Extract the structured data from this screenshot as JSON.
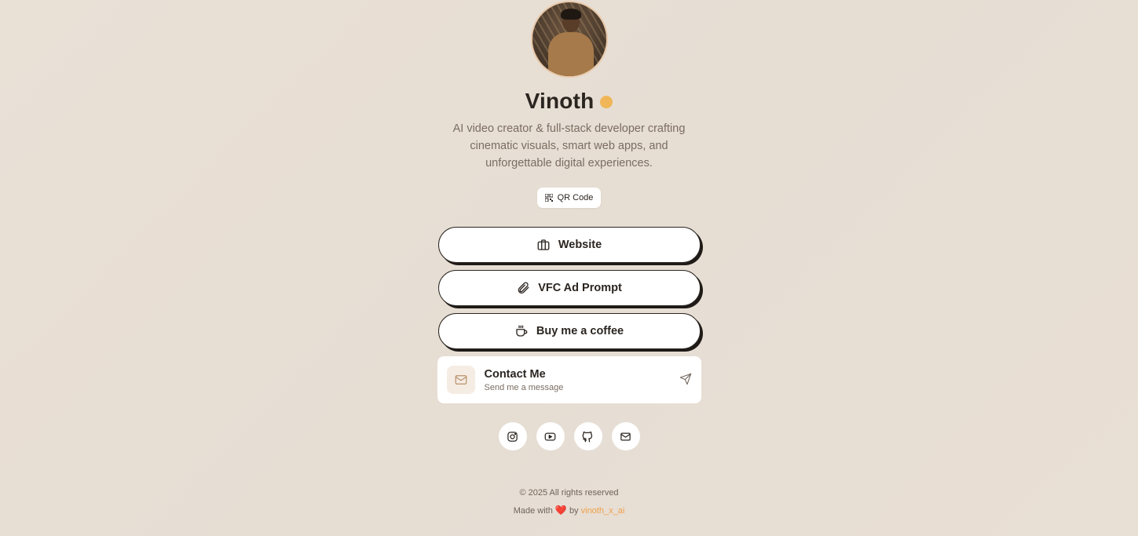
{
  "profile": {
    "name": "Vinoth",
    "bio": "AI video creator & full-stack developer crafting cinematic visuals, smart web apps, and unforgettable digital experiences.",
    "avatar_alt": "Vinoth avatar"
  },
  "qr": {
    "label": "QR Code",
    "icon": "qr-code-icon"
  },
  "links": [
    {
      "label": "Website",
      "icon": "briefcase-icon"
    },
    {
      "label": "VFC Ad Prompt",
      "icon": "paperclip-icon"
    },
    {
      "label": "Buy me a coffee",
      "icon": "coffee-cup-icon"
    }
  ],
  "contact": {
    "title": "Contact Me",
    "subtitle": "Send me a message",
    "icon": "mail-icon",
    "action_icon": "send-icon"
  },
  "socials": [
    {
      "icon": "instagram-icon"
    },
    {
      "icon": "youtube-icon"
    },
    {
      "icon": "github-icon"
    },
    {
      "icon": "mail-icon"
    }
  ],
  "footer": {
    "copyright": "© 2025 All rights reserved",
    "made_with_prefix": "Made with",
    "heart": "❤️",
    "by": "by",
    "author": "vinoth_x_ai"
  },
  "colors": {
    "background": "#e8dfd5",
    "accent_orange": "#f0a04a",
    "badge_yellow": "#f0b657",
    "text_dark": "#2b2520",
    "text_muted": "#7a6d62"
  }
}
